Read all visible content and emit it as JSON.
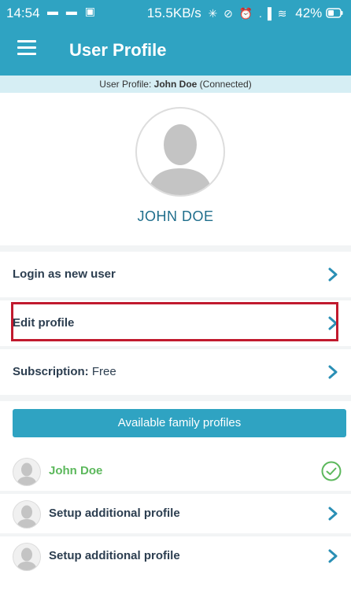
{
  "status_bar": {
    "time": "14:54",
    "notification_icons": "▬ ▬ ▣",
    "network_speed": "15.5KB/s",
    "system_icons": "✳ ⊘ ⏰ .▐ ≋",
    "battery": "42%"
  },
  "app_bar": {
    "title": "User Profile",
    "menu_icon": "hamburger-menu-icon"
  },
  "connection": {
    "prefix": "User Profile: ",
    "user": "John Doe",
    "status": " (Connected)"
  },
  "profile": {
    "name": "JOHN DOE",
    "avatar_icon": "person-silhouette-icon"
  },
  "menu": {
    "login_new_user": "Login as new user",
    "edit_profile": "Edit profile",
    "subscription_label": "Subscription:",
    "subscription_value": " Free"
  },
  "family_button": "Available family profiles",
  "family_profiles": [
    {
      "name": "John Doe",
      "active": true,
      "icon": "check-circle-icon"
    },
    {
      "name": "Setup additional profile",
      "active": false,
      "icon": "chevron-right-icon"
    },
    {
      "name": "Setup additional profile",
      "active": false,
      "icon": "chevron-right-icon"
    }
  ],
  "colors": {
    "primary": "#2fa3c2",
    "highlight_border": "#c11a2e",
    "active_green": "#5cb85c",
    "name_text": "#1f6e8c"
  }
}
